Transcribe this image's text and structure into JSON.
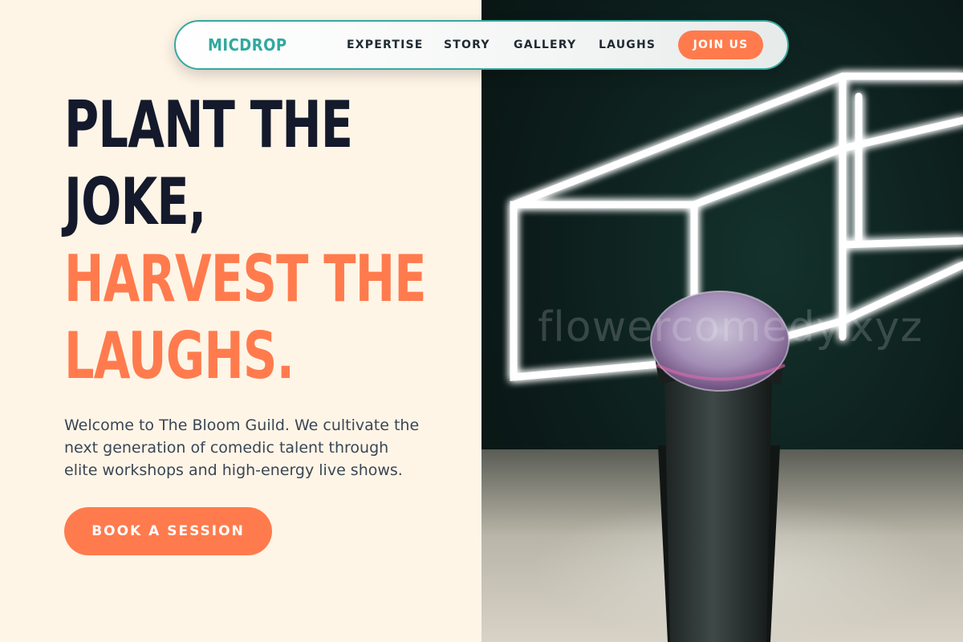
{
  "nav": {
    "logo": "MICDROP",
    "links": [
      "EXPERTISE",
      "STORY",
      "GALLERY",
      "LAUGHS"
    ],
    "cta": "JOIN US"
  },
  "hero": {
    "headline_dark": [
      "PLANT THE",
      "JOKE,"
    ],
    "headline_accent": [
      "HARVEST THE",
      "LAUGHS."
    ],
    "intro": "Welcome to The Bloom Guild. We cultivate the next generation of comedic talent through elite workshops and high-energy live shows.",
    "cta": "BOOK A SESSION"
  },
  "image": {
    "watermark": "flowercomedy.xyz"
  },
  "colors": {
    "accent": "#FF7B4D",
    "teal": "#2FA99F",
    "dark": "#141A2B",
    "background": "#FEF5E7"
  }
}
